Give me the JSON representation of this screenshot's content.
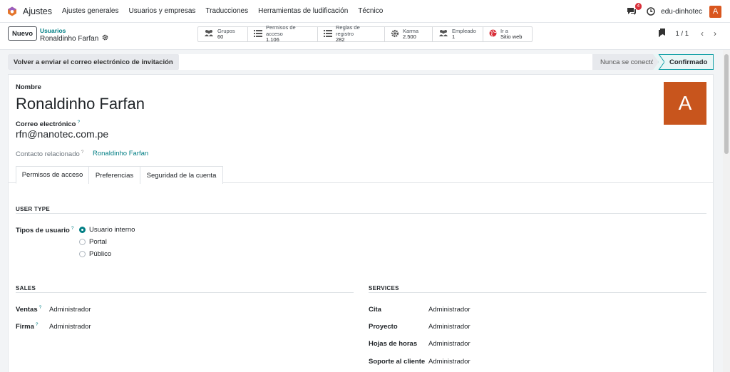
{
  "topnav": {
    "app_name": "Ajustes",
    "menu": [
      "Ajustes generales",
      "Usuarios y empresas",
      "Traducciones",
      "Herramientas de ludificación",
      "Técnico"
    ],
    "chat_count": "4",
    "company": "edu-dinhotec",
    "avatar_letter": "A"
  },
  "control": {
    "new_button": "Nuevo",
    "breadcrumb_parent": "Usuarios",
    "breadcrumb_current": "Ronaldinho Farfan",
    "stats": [
      {
        "label": "Grupos",
        "value": "60",
        "icon": "users-icon"
      },
      {
        "label": "Permisos de acceso",
        "value": "1.106",
        "icon": "list-icon"
      },
      {
        "label": "Reglas de registro",
        "value": "282",
        "icon": "list-icon"
      },
      {
        "label": "Karma",
        "value": "2.500",
        "icon": "gear-icon"
      },
      {
        "label": "Empleado",
        "value": "1",
        "icon": "users-icon"
      },
      {
        "label": "Ir a",
        "value": "Sitio web",
        "icon": "globe-icon"
      }
    ],
    "pager": "1 / 1"
  },
  "statusbar": {
    "resend_button": "Volver a enviar el correo electrónico de invitación",
    "stages": [
      "Nunca se conectó",
      "Confirmado"
    ]
  },
  "form": {
    "name_label": "Nombre",
    "name_value": "Ronaldinho Farfan",
    "email_label": "Correo electrónico",
    "email_help": "?",
    "email_value": "rfn@nanotec.com.pe",
    "contact_label": "Contacto relacionado",
    "contact_help": "?",
    "contact_value": "Ronaldinho Farfan",
    "avatar_letter": "A",
    "tabs": [
      "Permisos de acceso",
      "Preferencias",
      "Seguridad de la cuenta"
    ],
    "user_type_title": "USER TYPE",
    "user_type_label": "Tipos de usuario",
    "user_type_help": "?",
    "user_type_options": [
      "Usuario interno",
      "Portal",
      "Público"
    ],
    "sales_title": "SALES",
    "sales": [
      {
        "label": "Ventas",
        "help": "?",
        "value": "Administrador"
      },
      {
        "label": "Firma",
        "help": "?",
        "value": "Administrador"
      }
    ],
    "services_title": "SERVICES",
    "services": [
      {
        "label": "Cita",
        "value": "Administrador"
      },
      {
        "label": "Proyecto",
        "value": "Administrador"
      },
      {
        "label": "Hojas de horas",
        "value": "Administrador"
      },
      {
        "label": "Soporte al cliente",
        "value": "Administrador"
      }
    ]
  },
  "colors": {
    "accent": "#017e84",
    "avatar": "#c8551d",
    "badge": "#d9303a"
  }
}
